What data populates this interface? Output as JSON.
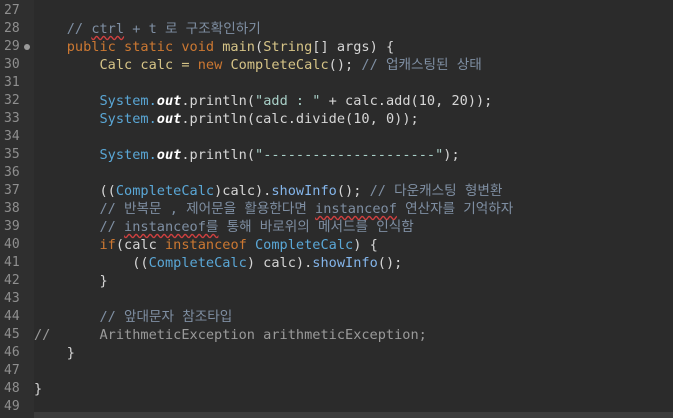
{
  "editor": {
    "lines": [
      {
        "num": "27",
        "tokens": []
      },
      {
        "num": "28",
        "tokens": [
          [
            "    ",
            "nm"
          ],
          [
            "// ",
            "cm"
          ],
          [
            "ctrl",
            "cmw"
          ],
          [
            " + t 로 구조확인하기",
            "cm"
          ]
        ]
      },
      {
        "num": "29",
        "fold": true,
        "tokens": [
          [
            "    ",
            "nm"
          ],
          [
            "public static void ",
            "kw"
          ],
          [
            "main",
            "ty"
          ],
          [
            "(",
            "nm"
          ],
          [
            "String",
            "ty"
          ],
          [
            "[] args) {",
            "nm"
          ]
        ]
      },
      {
        "num": "30",
        "tokens": [
          [
            "        ",
            "nm"
          ],
          [
            "Calc calc = ",
            "ty"
          ],
          [
            "new ",
            "kw"
          ],
          [
            "CompleteCalc",
            "ty"
          ],
          [
            "(); ",
            "nm"
          ],
          [
            "// 업캐스팅된 상태",
            "cm"
          ]
        ]
      },
      {
        "num": "31",
        "tokens": []
      },
      {
        "num": "32",
        "tokens": [
          [
            "        ",
            "nm"
          ],
          [
            "System.",
            "cl"
          ],
          [
            "out",
            "fl"
          ],
          [
            ".println(",
            "nm"
          ],
          [
            "\"add : \"",
            "st"
          ],
          [
            " + calc.add(10, 20));",
            "nm"
          ]
        ]
      },
      {
        "num": "33",
        "tokens": [
          [
            "        ",
            "nm"
          ],
          [
            "System.",
            "cl"
          ],
          [
            "out",
            "fl"
          ],
          [
            ".println(calc.divide(10, 0));",
            "nm"
          ]
        ]
      },
      {
        "num": "34",
        "tokens": []
      },
      {
        "num": "35",
        "tokens": [
          [
            "        ",
            "nm"
          ],
          [
            "System.",
            "cl"
          ],
          [
            "out",
            "fl"
          ],
          [
            ".println(",
            "nm"
          ],
          [
            "\"---------------------\"",
            "st"
          ],
          [
            ");",
            "nm"
          ]
        ]
      },
      {
        "num": "36",
        "tokens": []
      },
      {
        "num": "37",
        "tokens": [
          [
            "        ",
            "nm"
          ],
          [
            "((",
            "nm"
          ],
          [
            "CompleteCalc",
            "cl"
          ],
          [
            ")calc).",
            "nm"
          ],
          [
            "showInfo",
            "me"
          ],
          [
            "(); ",
            "nm"
          ],
          [
            "// 다운캐스팅 형변환",
            "cm"
          ]
        ]
      },
      {
        "num": "38",
        "tokens": [
          [
            "        ",
            "nm"
          ],
          [
            "// 반복문 , 제어문을 활용한다면 ",
            "cm"
          ],
          [
            "instanceof",
            "cmw"
          ],
          [
            " 연산자를 기억하자",
            "cm"
          ]
        ]
      },
      {
        "num": "39",
        "tokens": [
          [
            "        ",
            "nm"
          ],
          [
            "// ",
            "cm"
          ],
          [
            "instanceof를",
            "cmw"
          ],
          [
            " 통해 바로위의 메서드를 인식함",
            "cm"
          ]
        ]
      },
      {
        "num": "40",
        "tokens": [
          [
            "        ",
            "nm"
          ],
          [
            "if",
            "kw"
          ],
          [
            "(calc ",
            "nm"
          ],
          [
            "instanceof ",
            "kw"
          ],
          [
            "CompleteCalc",
            "cl"
          ],
          [
            ") {",
            "nm"
          ]
        ]
      },
      {
        "num": "41",
        "tokens": [
          [
            "            ",
            "nm"
          ],
          [
            "((",
            "nm"
          ],
          [
            "CompleteCalc",
            "cl"
          ],
          [
            ") calc).",
            "nm"
          ],
          [
            "showInfo",
            "me"
          ],
          [
            "();",
            "nm"
          ]
        ]
      },
      {
        "num": "42",
        "tokens": [
          [
            "        ",
            "nm"
          ],
          [
            "}",
            "nm"
          ]
        ]
      },
      {
        "num": "43",
        "tokens": []
      },
      {
        "num": "44",
        "tokens": [
          [
            "        ",
            "nm"
          ],
          [
            "// 앞대문자 참조타입",
            "cm"
          ]
        ]
      },
      {
        "num": "45",
        "tokens": [
          [
            "//      ",
            "gy"
          ],
          [
            "ArithmeticException arithmeticException;",
            "gy"
          ]
        ]
      },
      {
        "num": "46",
        "tokens": [
          [
            "    ",
            "nm"
          ],
          [
            "}",
            "nm"
          ]
        ]
      },
      {
        "num": "47",
        "tokens": []
      },
      {
        "num": "48",
        "tokens": [
          [
            "}",
            "nm"
          ]
        ]
      },
      {
        "num": "49",
        "tokens": []
      }
    ]
  }
}
